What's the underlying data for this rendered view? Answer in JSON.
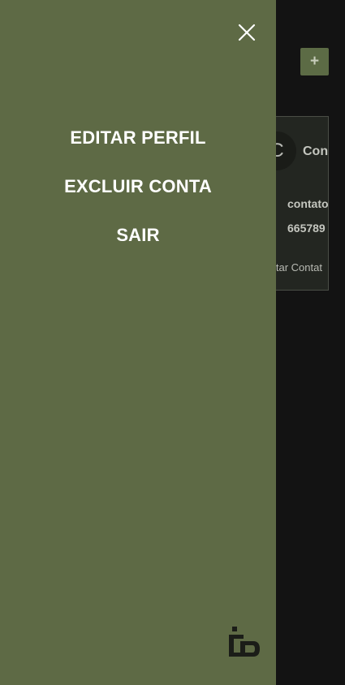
{
  "background": {
    "add_button": {
      "label": "+"
    },
    "contact_card": {
      "avatar_initial": "C",
      "name": "Con",
      "email": "contato",
      "phone": "665789",
      "edit_link": "itar Contat"
    }
  },
  "drawer": {
    "menu": {
      "edit_profile": "EDITAR PERFIL",
      "delete_account": "EXCLUIR CONTA",
      "logout": "SAIR"
    },
    "icons": {
      "close": "close-icon",
      "logo": "app-logo"
    },
    "colors": {
      "drawer_background": "#5e6a45",
      "app_background": "#131313",
      "card_background": "#232621"
    }
  }
}
